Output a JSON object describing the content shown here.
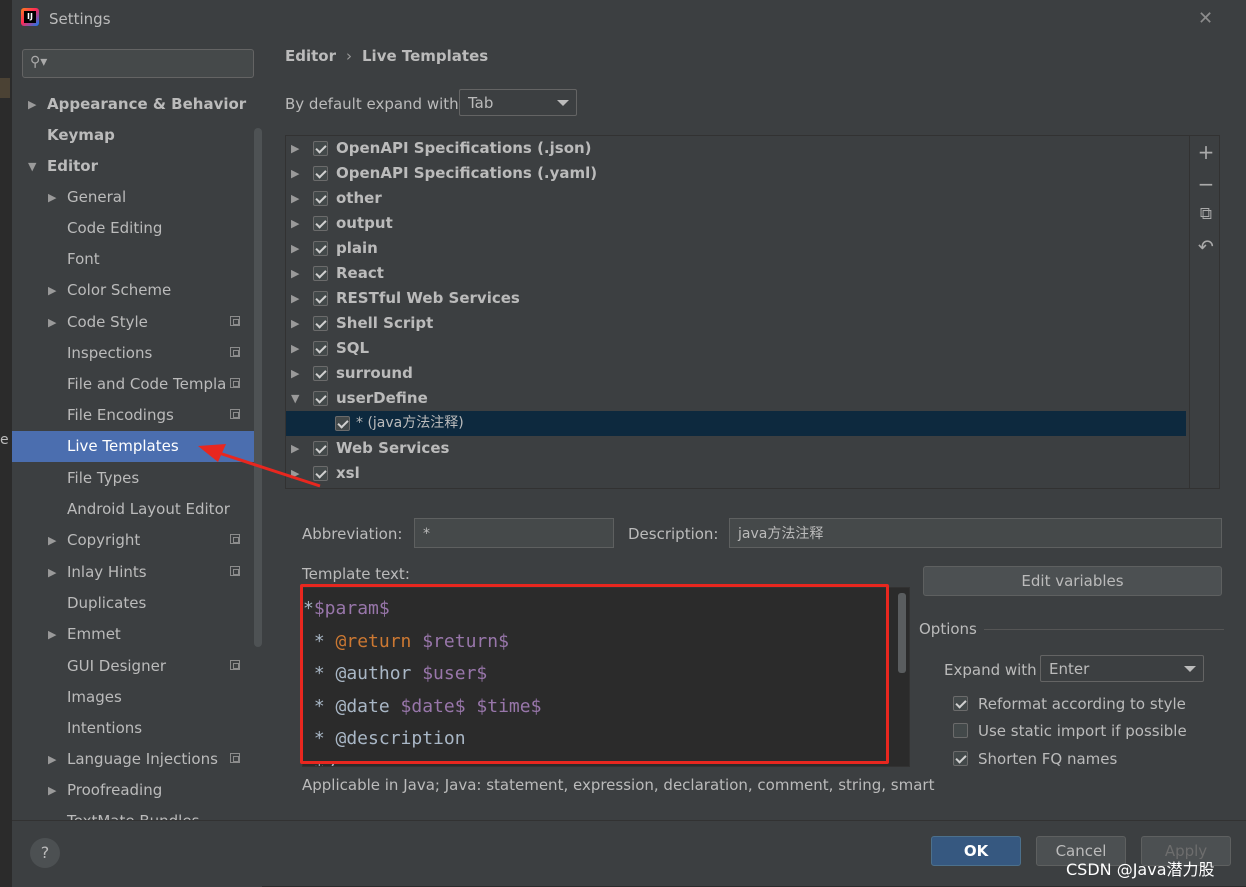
{
  "window": {
    "title": "Settings"
  },
  "search": {
    "placeholder": ""
  },
  "sidebar": {
    "items": [
      {
        "label": "Appearance & Behavior",
        "level": 0,
        "expander": "collapsed",
        "bold": true
      },
      {
        "label": "Keymap",
        "level": 0,
        "expander": "none",
        "bold": true
      },
      {
        "label": "Editor",
        "level": 0,
        "expander": "expanded",
        "bold": true
      },
      {
        "label": "General",
        "level": 1,
        "expander": "collapsed"
      },
      {
        "label": "Code Editing",
        "level": 1,
        "expander": "none"
      },
      {
        "label": "Font",
        "level": 1,
        "expander": "none"
      },
      {
        "label": "Color Scheme",
        "level": 1,
        "expander": "collapsed"
      },
      {
        "label": "Code Style",
        "level": 1,
        "expander": "collapsed",
        "project_icon": true
      },
      {
        "label": "Inspections",
        "level": 1,
        "expander": "none",
        "project_icon": true
      },
      {
        "label": "File and Code Templa",
        "level": 1,
        "expander": "none",
        "project_icon": true
      },
      {
        "label": "File Encodings",
        "level": 1,
        "expander": "none",
        "project_icon": true
      },
      {
        "label": "Live Templates",
        "level": 1,
        "expander": "none",
        "selected": true
      },
      {
        "label": "File Types",
        "level": 1,
        "expander": "none"
      },
      {
        "label": "Android Layout Editor",
        "level": 1,
        "expander": "none"
      },
      {
        "label": "Copyright",
        "level": 1,
        "expander": "collapsed",
        "project_icon": true
      },
      {
        "label": "Inlay Hints",
        "level": 1,
        "expander": "collapsed",
        "project_icon": true
      },
      {
        "label": "Duplicates",
        "level": 1,
        "expander": "none"
      },
      {
        "label": "Emmet",
        "level": 1,
        "expander": "collapsed"
      },
      {
        "label": "GUI Designer",
        "level": 1,
        "expander": "none",
        "project_icon": true
      },
      {
        "label": "Images",
        "level": 1,
        "expander": "none"
      },
      {
        "label": "Intentions",
        "level": 1,
        "expander": "none"
      },
      {
        "label": "Language Injections",
        "level": 1,
        "expander": "collapsed",
        "project_icon": true
      },
      {
        "label": "Proofreading",
        "level": 1,
        "expander": "collapsed"
      },
      {
        "label": "TextMate Bundles",
        "level": 1,
        "expander": "none"
      }
    ]
  },
  "breadcrumb": {
    "parent": "Editor",
    "current": "Live Templates"
  },
  "expand_default": {
    "label": "By default expand with",
    "value": "Tab"
  },
  "templates": [
    {
      "label": "OpenAPI Specifications (.json)",
      "checked": true,
      "expander": "collapsed"
    },
    {
      "label": "OpenAPI Specifications (.yaml)",
      "checked": true,
      "expander": "collapsed"
    },
    {
      "label": "other",
      "checked": true,
      "expander": "collapsed"
    },
    {
      "label": "output",
      "checked": true,
      "expander": "collapsed"
    },
    {
      "label": "plain",
      "checked": true,
      "expander": "collapsed"
    },
    {
      "label": "React",
      "checked": true,
      "expander": "collapsed"
    },
    {
      "label": "RESTful Web Services",
      "checked": true,
      "expander": "collapsed"
    },
    {
      "label": "Shell Script",
      "checked": true,
      "expander": "collapsed"
    },
    {
      "label": "SQL",
      "checked": true,
      "expander": "collapsed"
    },
    {
      "label": "surround",
      "checked": true,
      "expander": "collapsed"
    },
    {
      "label": "userDefine",
      "checked": true,
      "expander": "expanded"
    },
    {
      "label": "* (java方法注释)",
      "checked": true,
      "expander": "none",
      "child": true,
      "selected": true
    },
    {
      "label": "Web Services",
      "checked": true,
      "expander": "collapsed"
    },
    {
      "label": "xsl",
      "checked": true,
      "expander": "collapsed"
    }
  ],
  "toolbar_icons": [
    "plus-icon",
    "minus-icon",
    "copy-icon",
    "undo-icon"
  ],
  "abbreviation": {
    "label": "Abbreviation:",
    "value": "*"
  },
  "description": {
    "label": "Description:",
    "value": "java方法注释"
  },
  "template_text": {
    "label": "Template text:",
    "lines": [
      "*$param$",
      " * @return $return$",
      " * @author $user$",
      " * @date $date$ $time$",
      " * @description",
      " */"
    ]
  },
  "edit_variables": {
    "label": "Edit variables"
  },
  "applicable": {
    "text": "Applicable in Java; Java: statement, expression, declaration, comment, string, smart"
  },
  "options": {
    "title": "Options",
    "expand_with": {
      "label": "Expand with",
      "value": "Enter"
    },
    "checkboxes": [
      {
        "label": "Reformat according to style",
        "checked": true
      },
      {
        "label": "Use static import if possible",
        "checked": false
      },
      {
        "label": "Shorten FQ names",
        "checked": true
      }
    ]
  },
  "buttons": {
    "ok": "OK",
    "cancel": "Cancel",
    "apply": "Apply"
  },
  "watermark": "CSDN @Java潜力股",
  "colors": {
    "selection": "#4b6eaf",
    "annotation_red": "#e8271f",
    "primary_button": "#365880"
  }
}
